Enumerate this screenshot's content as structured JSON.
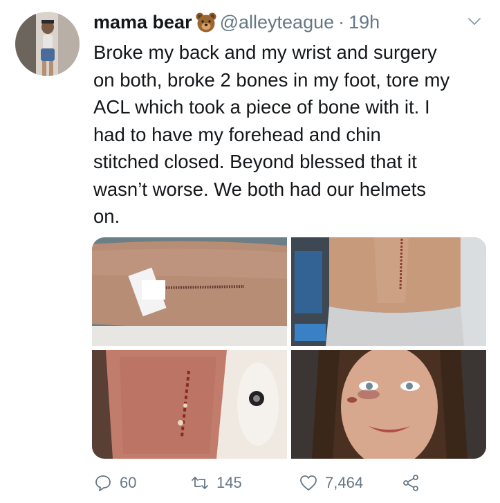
{
  "tweet": {
    "display_name": "mama bear",
    "name_emoji": "bear-face-emoji",
    "handle": "@alleyteague",
    "separator": "·",
    "time": "19h",
    "text_lines": [
      "Broke my back and my wrist and surgery",
      "on both, broke 2 bones in my foot, tore my",
      "ACL which took a piece of bone with it. I",
      "had to have my forehead and chin",
      "stitched closed. Beyond blessed that it",
      "wasn’t worse. We both had our helmets",
      "on."
    ]
  },
  "media": {
    "photos": [
      "stitched-leg-incision-photo",
      "stitched-back-incision-photo",
      "wrist-incision-photo",
      "bruised-face-selfie-photo"
    ]
  },
  "actions": {
    "reply_count": "60",
    "retweet_count": "145",
    "like_count": "7,464"
  },
  "colors": {
    "text": "#14171a",
    "secondary": "#657786",
    "background": "#ffffff"
  }
}
